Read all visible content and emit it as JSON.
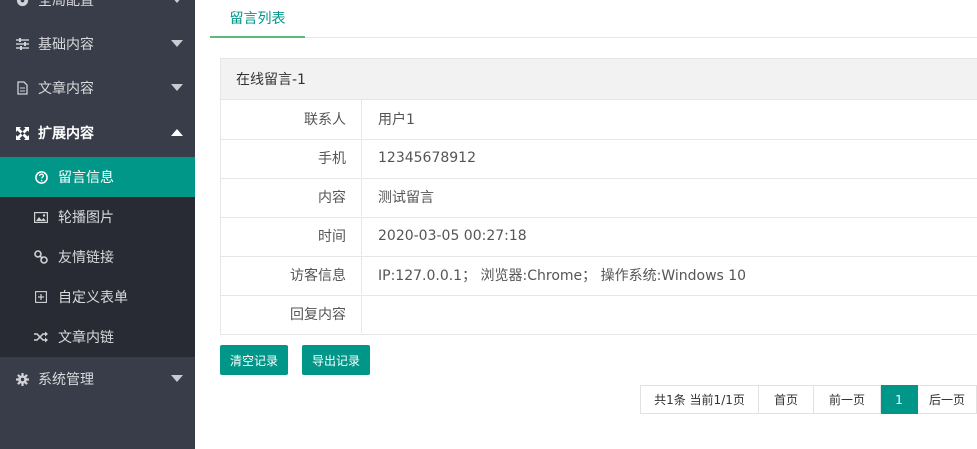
{
  "sidebar": {
    "items": [
      {
        "label": "全局配置",
        "icon": "globe-icon"
      },
      {
        "label": "基础内容",
        "icon": "sliders-icon"
      },
      {
        "label": "文章内容",
        "icon": "document-icon"
      },
      {
        "label": "扩展内容",
        "icon": "expand-icon"
      },
      {
        "label": "系统管理",
        "icon": "gear-icon"
      }
    ],
    "submenu": [
      {
        "label": "留言信息",
        "icon": "question-circle-icon"
      },
      {
        "label": "轮播图片",
        "icon": "image-icon"
      },
      {
        "label": "友情链接",
        "icon": "link-icon"
      },
      {
        "label": "自定义表单",
        "icon": "plus-square-icon"
      },
      {
        "label": "文章内链",
        "icon": "shuffle-icon"
      }
    ]
  },
  "tabs": [
    {
      "label": "留言列表"
    }
  ],
  "message": {
    "title": "在线留言-1",
    "rows": [
      {
        "label": "联系人",
        "value": "用户1"
      },
      {
        "label": "手机",
        "value": "12345678912"
      },
      {
        "label": "内容",
        "value": "测试留言"
      },
      {
        "label": "时间",
        "value": "2020-03-05 00:27:18"
      },
      {
        "label": "访客信息",
        "value": "IP:127.0.0.1； 浏览器:Chrome； 操作系统:Windows 10"
      },
      {
        "label": "回复内容",
        "value": ""
      }
    ]
  },
  "actions": {
    "clear_label": "清空记录",
    "export_label": "导出记录"
  },
  "pagination": {
    "summary": "共1条 当前1/1页",
    "first": "首页",
    "prev": "前一页",
    "current": "1",
    "next": "后一页"
  },
  "colors": {
    "accent": "#009688",
    "sidebar_bg": "#393D49",
    "submenu_bg": "#282B33"
  }
}
